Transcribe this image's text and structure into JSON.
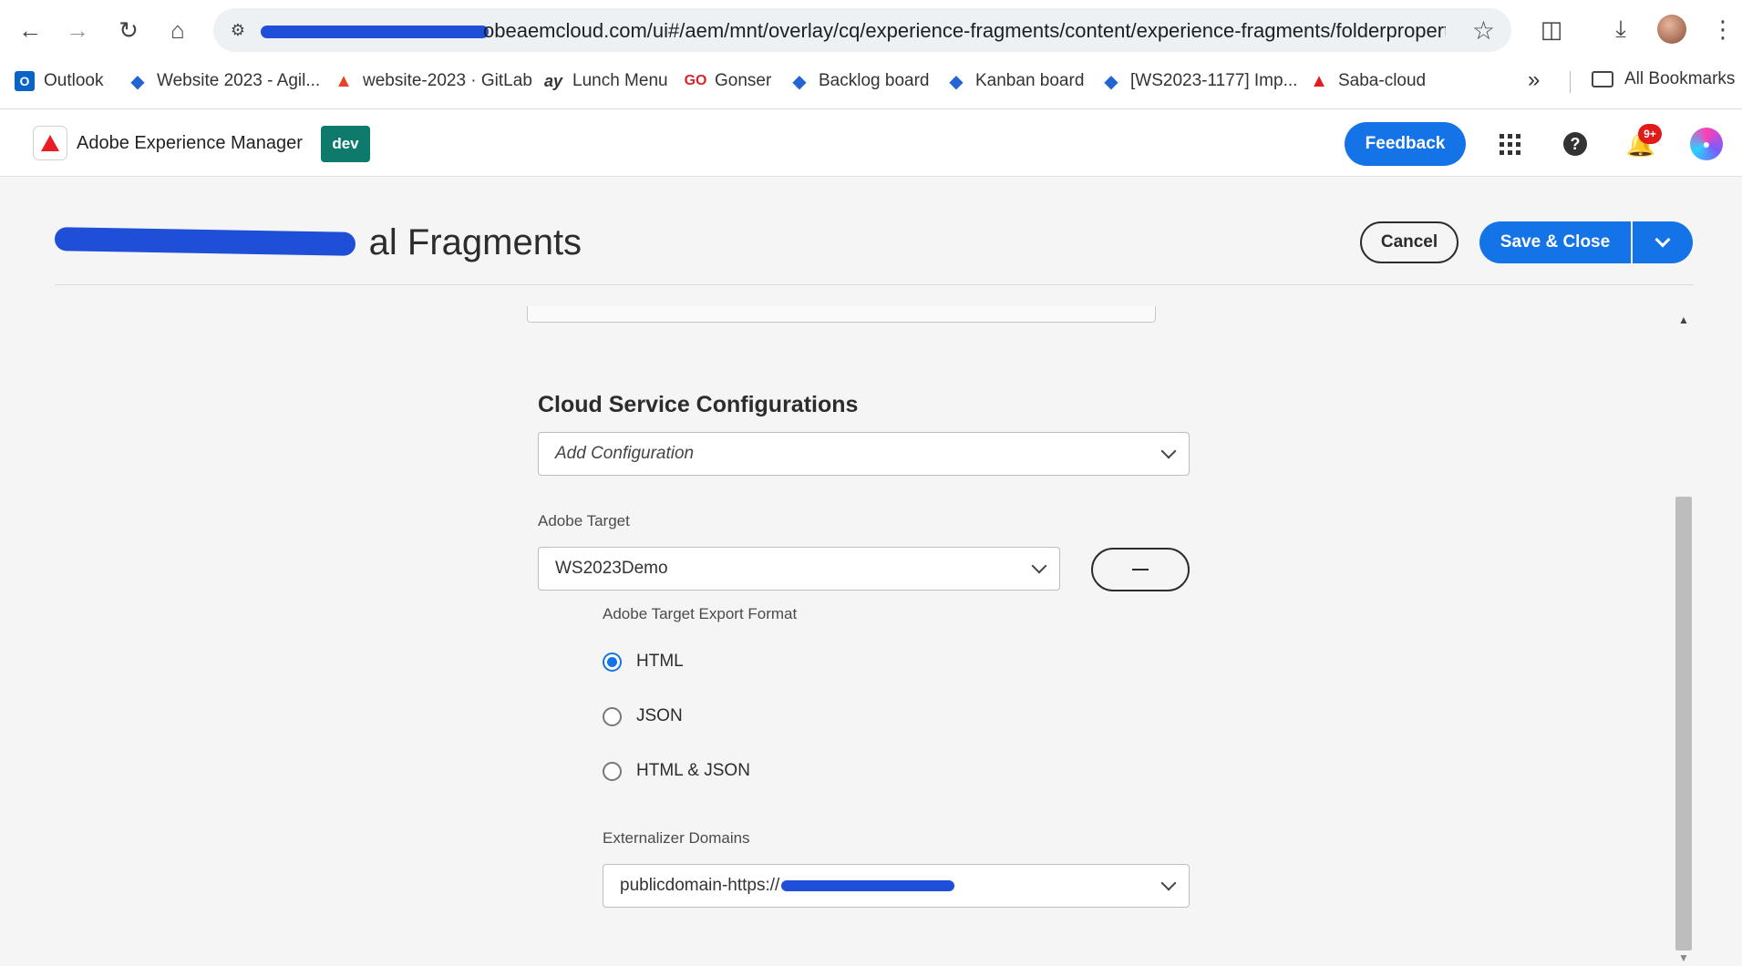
{
  "browser": {
    "url": "obeaemcloud.com/ui#/aem/mnt/overlay/cq/experience-fragments/content/experience-fragments/folderpropert...",
    "bookmarks": [
      {
        "label": "Outlook",
        "icon": "outlook-icon"
      },
      {
        "label": "Website 2023 - Agil...",
        "icon": "jira-icon"
      },
      {
        "label": "website-2023 · GitLab",
        "icon": "gitlab-icon"
      },
      {
        "label": "Lunch Menu",
        "icon": "lunch-icon"
      },
      {
        "label": "Gonser",
        "icon": "gonser-icon"
      },
      {
        "label": "Backlog board",
        "icon": "jira-icon"
      },
      {
        "label": "Kanban board",
        "icon": "jira-icon"
      },
      {
        "label": "[WS2023-1177] Imp...",
        "icon": "jira-icon"
      },
      {
        "label": "Saba-cloud",
        "icon": "adobe-icon"
      }
    ],
    "more_label": "»",
    "all_bookmarks": "All Bookmarks"
  },
  "aem": {
    "product": "Adobe Experience Manager",
    "env": "dev",
    "feedback": "Feedback",
    "notif_count": "9+",
    "accent": "#1473e6"
  },
  "dialog": {
    "title_visible": "al Fragments",
    "cancel": "Cancel",
    "save": "Save & Close"
  },
  "form": {
    "cloud_section": "Cloud Service Configurations",
    "add_config_placeholder": "Add Configuration",
    "target_label": "Adobe Target",
    "target_value": "WS2023Demo",
    "export_label": "Adobe Target Export Format",
    "export_options": [
      {
        "label": "HTML",
        "checked": true
      },
      {
        "label": "JSON",
        "checked": false
      },
      {
        "label": "HTML & JSON",
        "checked": false
      }
    ],
    "externalizer_label": "Externalizer Domains",
    "externalizer_value": "publicdomain-https://"
  }
}
